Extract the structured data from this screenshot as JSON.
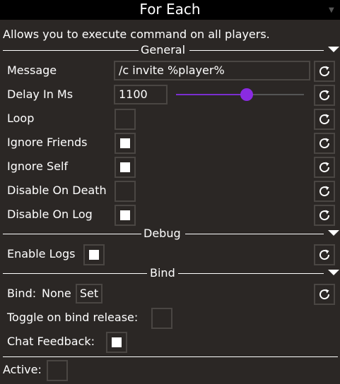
{
  "window": {
    "title": "For Each"
  },
  "description": "Allows you to execute command on all players.",
  "sections": {
    "general": "General",
    "debug": "Debug",
    "bind": "Bind"
  },
  "general": {
    "message": {
      "label": "Message",
      "value": "/c invite %player%"
    },
    "delay": {
      "label": "Delay In Ms",
      "value": "1100",
      "slider_fraction": 0.55
    },
    "loop": {
      "label": "Loop",
      "checked": false
    },
    "ignore_friends": {
      "label": "Ignore Friends",
      "checked": true
    },
    "ignore_self": {
      "label": "Ignore Self",
      "checked": true
    },
    "disable_on_death": {
      "label": "Disable On Death",
      "checked": false
    },
    "disable_on_log": {
      "label": "Disable On Log",
      "checked": true
    }
  },
  "debug": {
    "enable_logs": {
      "label": "Enable Logs",
      "checked": true
    }
  },
  "bind": {
    "label": "Bind:",
    "value": "None",
    "set_label": "Set",
    "toggle_release": {
      "label": "Toggle on bind release:",
      "checked": false
    },
    "chat_feedback": {
      "label": "Chat Feedback:",
      "checked": true
    }
  },
  "active": {
    "label": "Active:",
    "checked": false
  },
  "colors": {
    "accent": "#8a2be2",
    "background": "#2b2725",
    "titlebar": "#000000"
  },
  "icons": {
    "reset": "reset-icon",
    "collapse": "chevron-down-icon"
  }
}
